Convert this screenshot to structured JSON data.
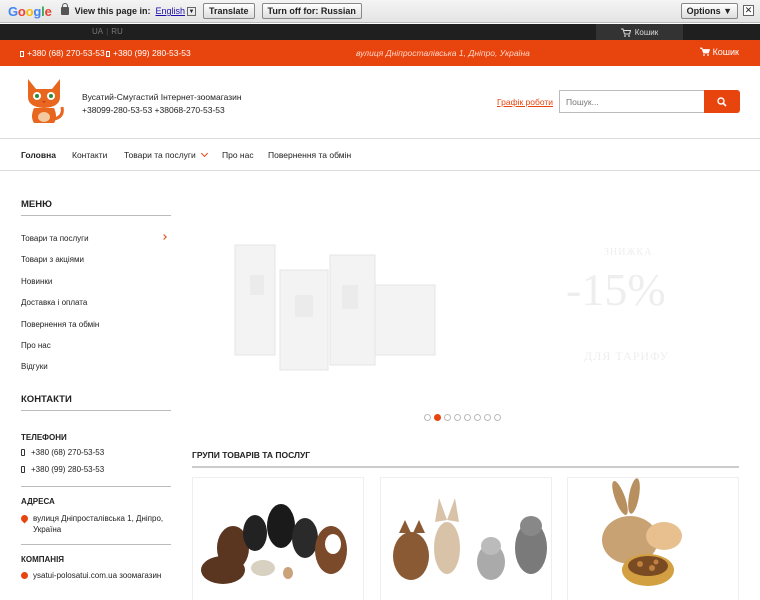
{
  "translate_bar": {
    "logo": [
      "G",
      "o",
      "o",
      "g",
      "l",
      "e"
    ],
    "view_text": "View this page in:",
    "language": "English",
    "translate_label": "Translate",
    "turn_off_label": "Turn off for: Russian",
    "options_label": "Options ▼",
    "close_label": "✕"
  },
  "top_strip": {
    "lang_ua": "UA",
    "lang_ru": "RU",
    "cart_label": "Кошик"
  },
  "contact_bar": {
    "phone1": "+380 (68) 270-53-53",
    "phone2": "+380 (99) 280-53-53",
    "address": "вулиця Дніпросталівська 1, Дніпро, Україна",
    "cart_label": "Кошик"
  },
  "header": {
    "shop_name": "Вусатий-Смугастий Інтернет-зоомагазин +38099-280-53-53 +38068-270-53-53",
    "schedule_link": "Графік роботи",
    "search_placeholder": "Пошук..."
  },
  "nav": {
    "items": [
      "Головна",
      "Контакти",
      "Товари та послуги",
      "Про нас",
      "Повернення та обмін"
    ]
  },
  "sidebar": {
    "menu_title": "МЕНЮ",
    "menu_items": [
      "Товари та послуги",
      "Товари з акціями",
      "Новинки",
      "Доставка і оплата",
      "Повернення та обмін",
      "Про нас",
      "Відгуки"
    ],
    "contacts_title": "КОНТАКТИ",
    "phones_title": "ТЕЛЕФОНИ",
    "phones": [
      "+380 (68) 270-53-53",
      "+380 (99) 280-53-53"
    ],
    "address_title": "АДРЕСА",
    "address": "вулиця Дніпросталівська 1, Дніпро, Україна",
    "company_title": "КОМПАНІЯ",
    "company": "ysatui-polosatui.com.ua зоомагазин"
  },
  "banner": {
    "top_text": "ЗНИЖКА",
    "discount": "-15%",
    "bottom_text": "ДЛЯ ТАРИФУ",
    "slide_count": 8,
    "active_slide": 2
  },
  "groups": {
    "title": "ГРУПИ ТОВАРІВ ТА ПОСЛУГ",
    "cards": [
      "dogs-image",
      "cats-image",
      "rodents-image"
    ]
  },
  "colors": {
    "accent": "#e8440e",
    "dark": "#1f1f1f"
  }
}
